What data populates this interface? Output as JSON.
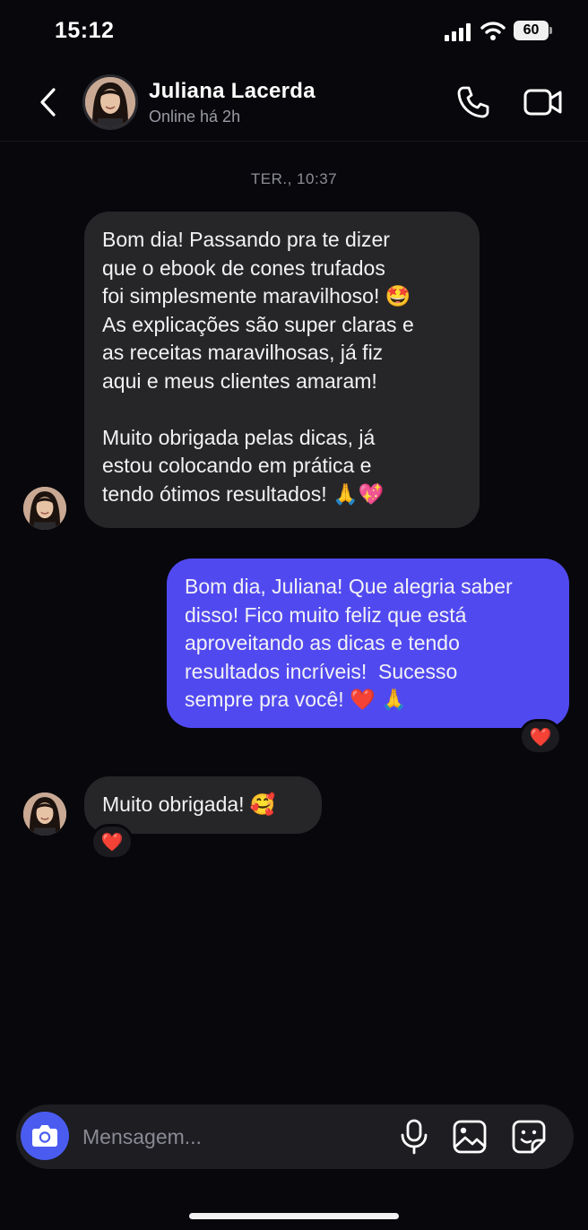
{
  "status_bar": {
    "time": "15:12",
    "battery": "60"
  },
  "header": {
    "contact_name": "Juliana Lacerda",
    "contact_status": "Online há 2h",
    "icons": [
      "back-icon",
      "phone-icon",
      "video-camera-icon"
    ]
  },
  "conversation": {
    "day_stamp": "TER., 10:37",
    "messages": [
      {
        "direction": "incoming",
        "text": "Bom dia! Passando pra te dizer\nque o ebook de cones trufados\nfoi simplesmente maravilhoso! 🤩\nAs explicações são super claras e\nas receitas maravilhosas, já fiz\naqui e meus clientes amaram!\n\nMuito obrigada pelas dicas, já\nestou colocando em prática e\ntendo ótimos resultados! 🙏💖"
      },
      {
        "direction": "outgoing",
        "text": "Bom dia, Juliana! Que alegria saber\ndisso! Fico muito feliz que está\naproveitando as dicas e tendo\nresultados incríveis!  Sucesso\nsempre pra você! ❤️ 🙏",
        "reaction": "❤️"
      },
      {
        "direction": "incoming",
        "text": "Muito obrigada! 🥰",
        "reaction": "❤️"
      }
    ]
  },
  "composer": {
    "placeholder": "Mensagem...",
    "icons": [
      "camera-icon",
      "microphone-icon",
      "gallery-icon",
      "sticker-icon"
    ]
  },
  "colors": {
    "background": "#08080c",
    "incoming_bubble": "#262629",
    "outgoing_bubble": "#5149f0",
    "camera_button": "#4a5cf0"
  }
}
